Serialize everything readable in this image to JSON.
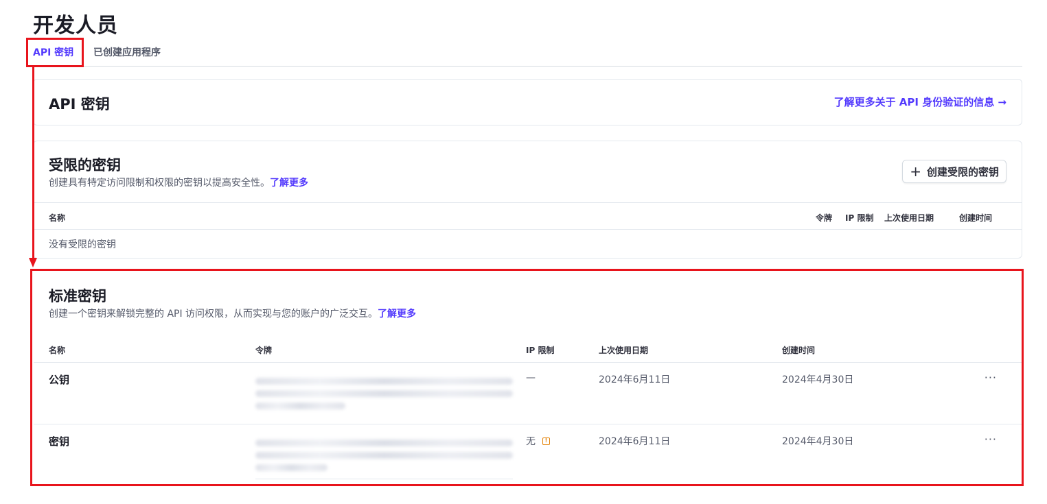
{
  "page": {
    "title": "开发人员"
  },
  "tabs": [
    {
      "label": "API 密钥",
      "active": true
    },
    {
      "label": "已创建应用程序",
      "active": false
    }
  ],
  "api_keys_card": {
    "heading": "API 密钥",
    "learn_link": "了解更多关于 API 身份验证的信息 →"
  },
  "restricted": {
    "heading": "受限的密钥",
    "description": "创建具有特定访问限制和权限的密钥以提高安全性。",
    "learn_more": "了解更多",
    "create_button": "创建受限的密钥",
    "columns": {
      "name": "名称",
      "token": "令牌",
      "ip": "IP 限制",
      "last_used": "上次使用日期",
      "created": "创建时间"
    },
    "empty": "没有受限的密钥"
  },
  "standard": {
    "heading": "标准密钥",
    "description": "创建一个密钥来解锁完整的 API 访问权限，从而实现与您的账户的广泛交互。",
    "learn_more": "了解更多",
    "columns": {
      "name": "名称",
      "token": "令牌",
      "ip": "IP 限制",
      "last_used": "上次使用日期",
      "created": "创建时间"
    },
    "rows": [
      {
        "name": "公钥",
        "ip": "—",
        "ip_warning": false,
        "last_used": "2024年6月11日",
        "created": "2024年4月30日",
        "more": "···"
      },
      {
        "name": "密钥",
        "ip": "无",
        "ip_warning": true,
        "last_used": "2024年6月11日",
        "created": "2024年4月30日",
        "more": "···"
      }
    ]
  },
  "colors": {
    "accent": "#533afd",
    "highlight": "#e8141c",
    "warning": "#e5850b"
  },
  "icons": {
    "plus": "plus-icon",
    "warning": "warning-icon",
    "more": "more-horizontal-icon",
    "arrow": "arrow-right-icon"
  }
}
